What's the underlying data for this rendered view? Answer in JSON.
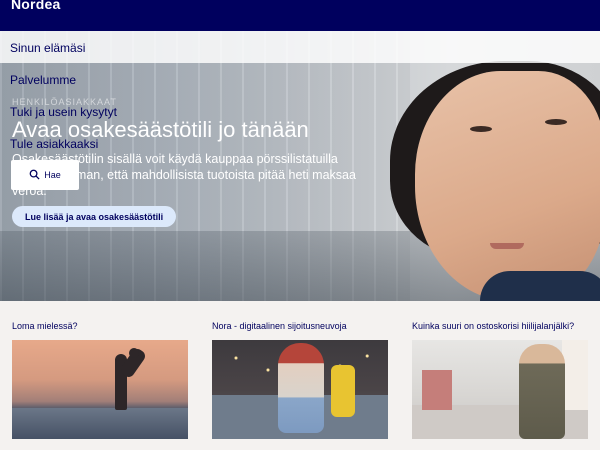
{
  "header": {
    "logo": "Nordea"
  },
  "nav": {
    "items": [
      {
        "label": "Sinun elämäsi"
      },
      {
        "label": "Palvelumme"
      },
      {
        "label": "Tuki ja usein kysytyt"
      },
      {
        "label": "Tule asiakkaaksi"
      }
    ],
    "ghost_label": "HENKILÖASIAKKAAT",
    "search_label": "Hae"
  },
  "hero": {
    "title": "Avaa osakesäästötili jo tänään",
    "text": "Osakesäästötilin sisällä voit käydä kauppaa pörssilistatuilla osakkeilla ilman, että mahdollisista tuotoista pitää heti maksaa veroa.",
    "cta": "Lue lisää ja avaa osakesäästötili"
  },
  "cards": [
    {
      "title": "Loma mielessä?"
    },
    {
      "title": "Nora - digitaalinen sijoitusneuvoja"
    },
    {
      "title": "Kuinka suuri on ostoskorisi hiilijalanjälki?"
    }
  ],
  "colors": {
    "brand": "#00005e",
    "cta_bg": "#dce9fb",
    "page_bg": "#f4f2f0"
  }
}
